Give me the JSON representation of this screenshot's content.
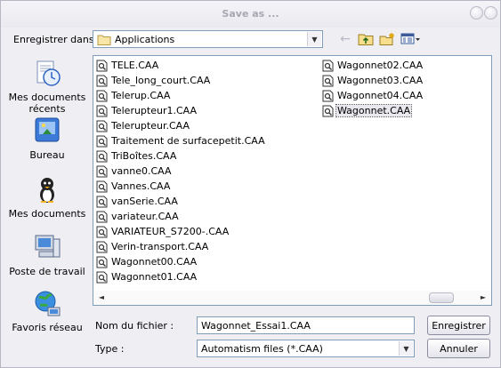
{
  "dialog": {
    "title": "Save as ..."
  },
  "lookin": {
    "label": "Enregistrer dans :",
    "value": "Applications"
  },
  "toolbar": {
    "icons": [
      "back-arrow-icon",
      "up-folder-icon",
      "new-folder-icon",
      "view-menu-icon"
    ]
  },
  "places": [
    {
      "label": "Mes documents récents",
      "icon": "recent-documents-icon"
    },
    {
      "label": "Bureau",
      "icon": "desktop-icon"
    },
    {
      "label": "Mes documents",
      "icon": "my-documents-icon"
    },
    {
      "label": "Poste de travail",
      "icon": "workstation-icon"
    },
    {
      "label": "Favoris réseau",
      "icon": "network-favorites-icon"
    }
  ],
  "files": {
    "column1": [
      "TELE.CAA",
      "Tele_long_court.CAA",
      "Telerup.CAA",
      "Telerupteur1.CAA",
      "Telerupteur.CAA",
      "Traitement de surfacepetit.CAA",
      "TriBoîtes.CAA",
      "vanne0.CAA",
      "Vannes.CAA",
      "vanSerie.CAA",
      "variateur.CAA",
      "VARIATEUR_S7200-.CAA",
      "Verin-transport.CAA",
      "Wagonnet00.CAA",
      "Wagonnet01.CAA"
    ],
    "column2": [
      "Wagonnet02.CAA",
      "Wagonnet03.CAA",
      "Wagonnet04.CAA",
      "Wagonnet.CAA"
    ],
    "selected": "Wagonnet.CAA"
  },
  "filename": {
    "label": "Nom du fichier :",
    "value": "Wagonnet_Essai1.CAA"
  },
  "filetype": {
    "label": "Type :",
    "value": "Automatism files (*.CAA)"
  },
  "buttons": {
    "save": "Enregistrer",
    "cancel": "Annuler"
  }
}
